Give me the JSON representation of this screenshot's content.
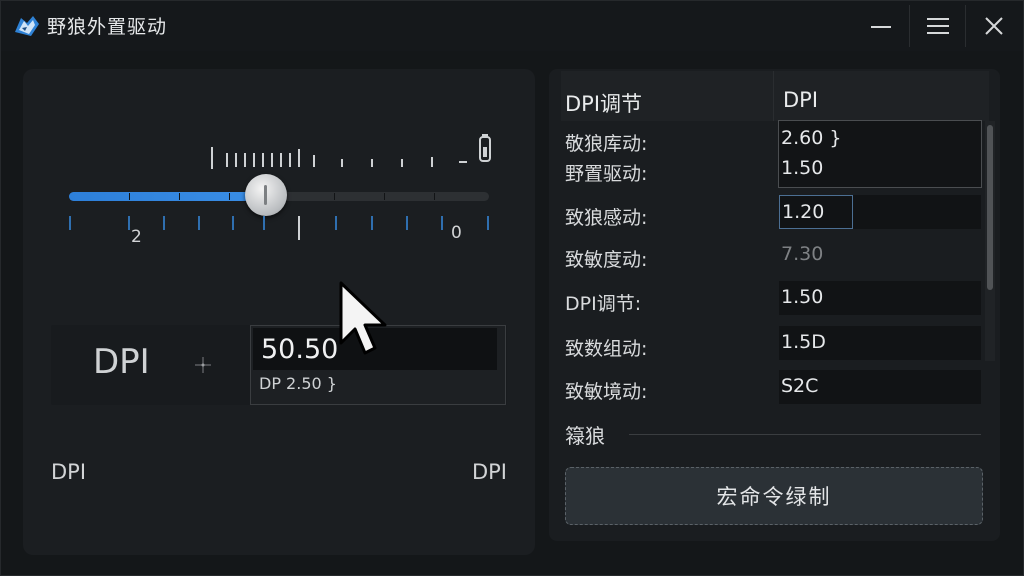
{
  "app": {
    "title": "野狼外置驱动",
    "logo_icon": "wolf-logo-icon"
  },
  "titlebar": {
    "minimize_icon": "minimize-icon",
    "menu_icon": "hamburger-menu-icon",
    "close_icon": "close-icon"
  },
  "left": {
    "slider": {
      "value_fraction": 0.47,
      "end_icon": "battery-icon"
    },
    "scale_labels": [
      "2",
      "0"
    ],
    "dpi_label": "DPI",
    "dpi_value": "50.50",
    "dpi_sub": "DP 2.50 }",
    "footer_left": "DPI",
    "footer_right": "DPI"
  },
  "right": {
    "header": {
      "col1": "DPI调节",
      "col2": "DPI"
    },
    "rows": [
      {
        "label": "敬狼库动:",
        "value": "2.60 }"
      },
      {
        "label": "野置驱动:",
        "value": "1.50"
      },
      {
        "label": "致狼感动:",
        "value": "1.20"
      },
      {
        "label": "致敏度动:",
        "value": "7.30"
      },
      {
        "label": "DPI调节:",
        "value": "1.50"
      },
      {
        "label": "致数组动:",
        "value": "1.5D"
      },
      {
        "label": "致敏境动:",
        "value": "S2C"
      }
    ],
    "section_title": "簶狼",
    "macro_button": "宏命令绿制"
  },
  "colors": {
    "accent": "#2d7fd9",
    "panel": "#1b1e21",
    "background": "#141719"
  }
}
